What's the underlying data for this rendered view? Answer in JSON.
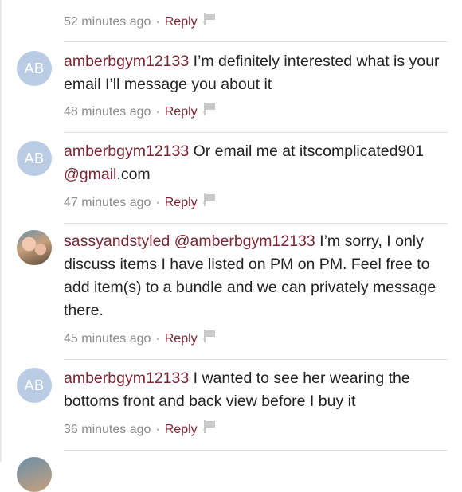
{
  "top_meta": {
    "time": "52 minutes ago",
    "reply": "Reply"
  },
  "comments": [
    {
      "avatar": "AB",
      "username": "amberbgym12133",
      "text": " I’m definitely interested what is your email I’ll message you about it",
      "time": "48 minutes ago",
      "reply": "Reply"
    },
    {
      "avatar": "AB",
      "username": "amberbgym12133",
      "text_before": " Or email me at itscomplicated901 ",
      "mention": "@gmail",
      "text_after": ".com",
      "time": "47 minutes ago",
      "reply": "Reply"
    },
    {
      "avatar": "photo",
      "username": "sassyandstyled",
      "mention": "@amberbgym12133",
      "text": " I’m sorry, I only discuss items I have listed on PM on PM. Feel free to add item(s) to a bundle and we can privately message there.",
      "time": "45 minutes ago",
      "reply": "Reply"
    },
    {
      "avatar": "AB",
      "username": "amberbgym12133",
      "text": " I wanted to see her wearing the bottoms front and back view before I buy it",
      "time": "36 minutes ago",
      "reply": "Reply"
    }
  ],
  "colors": {
    "accent": "#7b2432",
    "meta": "#8a8a8a",
    "avatar_bg": "#b9cce3"
  },
  "icons": {
    "flag": "flag-icon"
  }
}
